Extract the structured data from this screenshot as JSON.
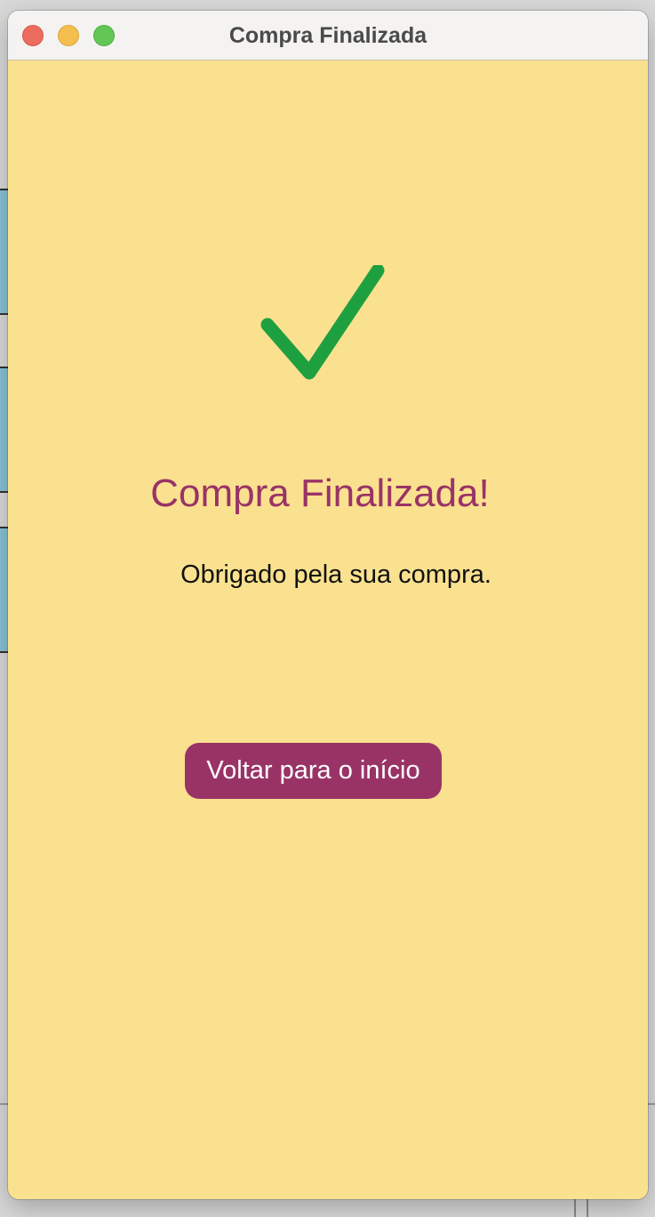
{
  "window": {
    "title": "Compra Finalizada"
  },
  "main": {
    "icon": "checkmark-icon",
    "heading": "Compra Finalizada!",
    "message": "Obrigado pela sua compra.",
    "back_button_label": "Voltar para o início"
  },
  "colors": {
    "background": "#fae18f",
    "accent": "#993366",
    "check": "#1fa040"
  }
}
